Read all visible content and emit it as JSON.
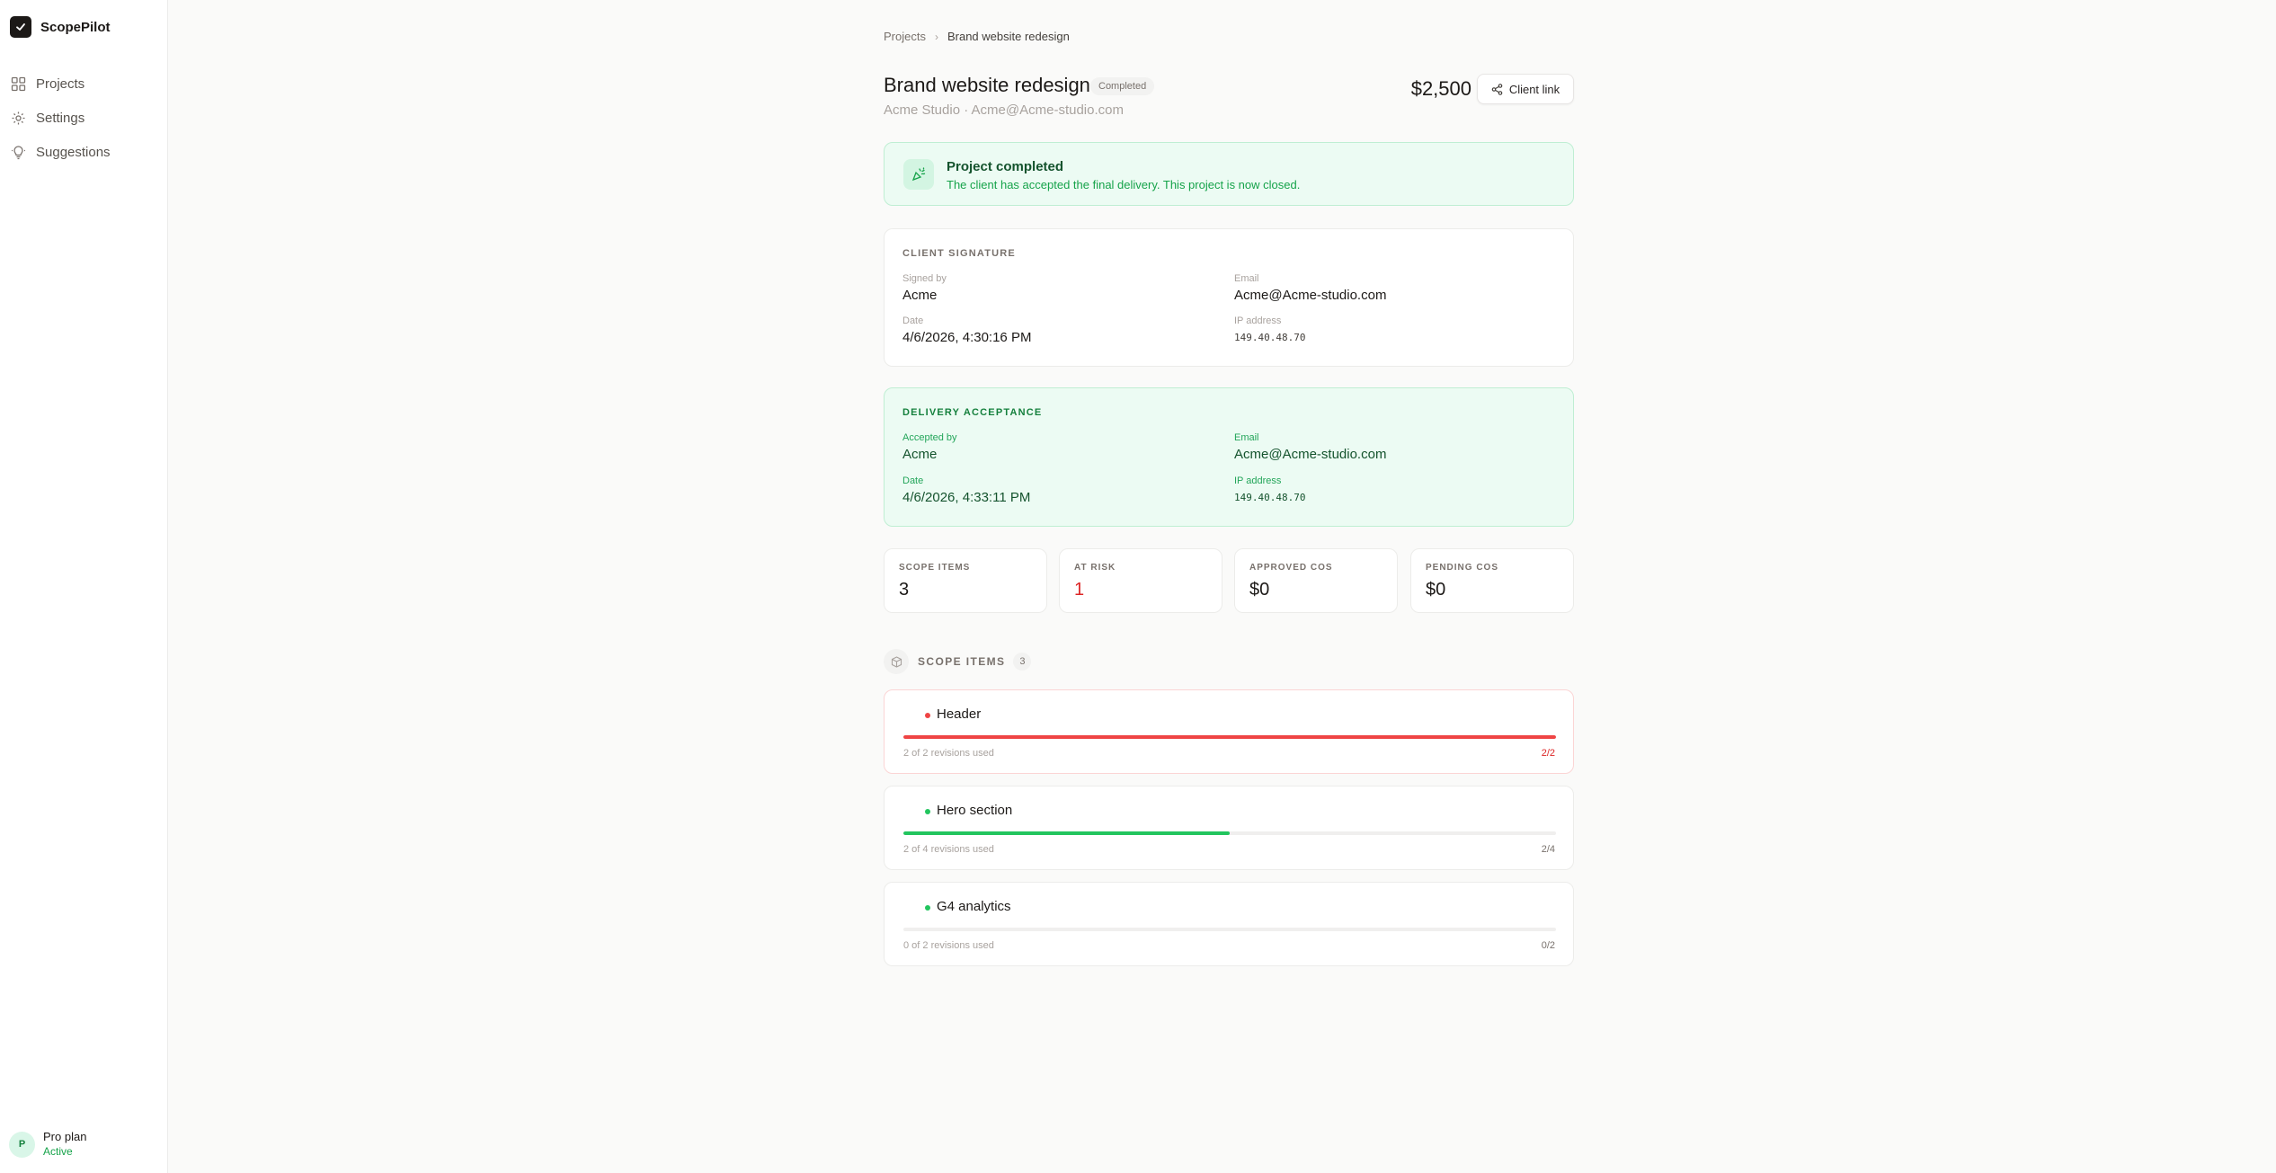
{
  "app": {
    "name": "ScopePilot"
  },
  "sidebar": {
    "items": [
      {
        "label": "Projects",
        "icon": "grid-icon"
      },
      {
        "label": "Settings",
        "icon": "gear-icon"
      },
      {
        "label": "Suggestions",
        "icon": "lightbulb-icon"
      }
    ],
    "plan": {
      "avatar": "P",
      "name": "Pro plan",
      "status": "Active"
    }
  },
  "breadcrumb": {
    "parent": "Projects",
    "current": "Brand website redesign"
  },
  "project": {
    "title": "Brand website redesign",
    "status": "Completed",
    "subtitle": "Acme Studio · Acme@Acme-studio.com",
    "price": "$2,500",
    "client_link_label": "Client link"
  },
  "banner": {
    "title": "Project completed",
    "text": "The client has accepted the final delivery. This project is now closed."
  },
  "client_signature": {
    "heading": "CLIENT SIGNATURE",
    "signed_by_label": "Signed by",
    "signed_by": "Acme",
    "email_label": "Email",
    "email": "Acme@Acme-studio.com",
    "date_label": "Date",
    "date": "4/6/2026, 4:30:16 PM",
    "ip_label": "IP address",
    "ip": "149.40.48.70"
  },
  "delivery_acceptance": {
    "heading": "DELIVERY ACCEPTANCE",
    "accepted_by_label": "Accepted by",
    "accepted_by": "Acme",
    "email_label": "Email",
    "email": "Acme@Acme-studio.com",
    "date_label": "Date",
    "date": "4/6/2026, 4:33:11 PM",
    "ip_label": "IP address",
    "ip": "149.40.48.70"
  },
  "stats": [
    {
      "label": "SCOPE ITEMS",
      "value": "3"
    },
    {
      "label": "AT RISK",
      "value": "1"
    },
    {
      "label": "APPROVED COS",
      "value": "$0"
    },
    {
      "label": "PENDING COS",
      "value": "$0"
    }
  ],
  "scope": {
    "title": "SCOPE ITEMS",
    "count": "3",
    "items": [
      {
        "name": "Header",
        "usage": "2 of 2 revisions used",
        "count": "2/2",
        "used": 2,
        "total": 2,
        "color": "#ef4444"
      },
      {
        "name": "Hero section",
        "usage": "2 of 4 revisions used",
        "count": "2/4",
        "used": 2,
        "total": 4,
        "color": "#22c55e"
      },
      {
        "name": "G4 analytics",
        "usage": "0 of 2 revisions used",
        "count": "0/2",
        "used": 0,
        "total": 2,
        "color": "#22c55e"
      }
    ]
  },
  "colors": {
    "accent_green": "#16a34a",
    "risk_red": "#dc2626"
  }
}
